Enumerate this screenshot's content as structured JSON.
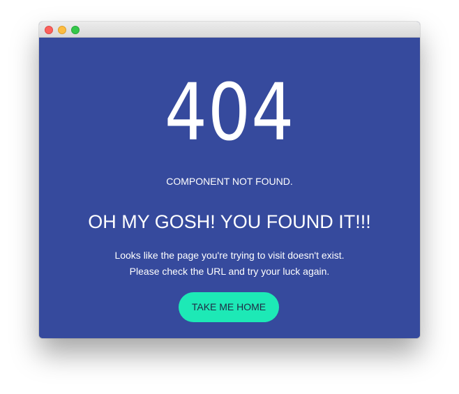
{
  "window": {
    "background": "#364a9d",
    "controls": [
      "close",
      "minimize",
      "zoom"
    ]
  },
  "error": {
    "code": "404",
    "subtitle": "COMPONENT NOT FOUND.",
    "headline": "OH MY GOSH! YOU FOUND IT!!!",
    "description_line1": "Looks like the page you're trying to visit doesn't exist.",
    "description_line2": "Please check the URL and try your luck again."
  },
  "actions": {
    "home_label": "TAKE ME HOME",
    "home_color": "#1de9b6"
  }
}
